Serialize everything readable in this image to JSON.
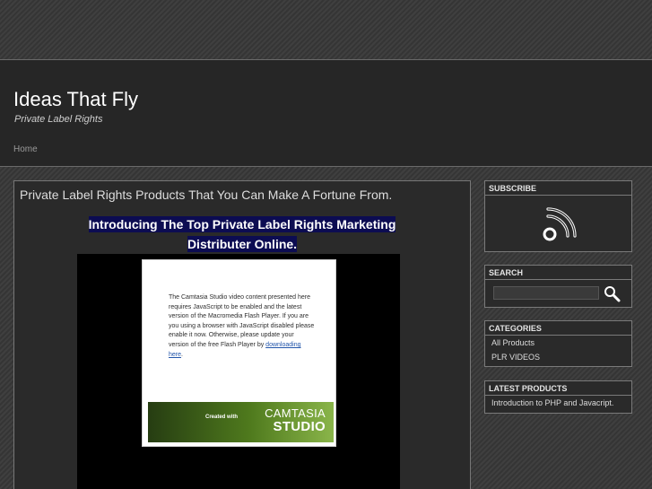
{
  "site": {
    "title": "Ideas That Fly",
    "tagline": "Private Label Rights",
    "nav": [
      {
        "label": "Home"
      }
    ]
  },
  "post": {
    "title": "Private Label Rights Products That You Can Make A Fortune From.",
    "promo_line1": "Introducing The Top Private Label Rights Marketing",
    "promo_line2": "Distributer Online.",
    "flash_message": "The Camtasia Studio video content presented here requires JavaScript to be enabled and the latest version of the Macromedia Flash Player. If you are you using a browser with JavaScript disabled please enable it now. Otherwise, please update your version of the free Flash Player by",
    "flash_link": "downloading here",
    "flash_tail": ".",
    "banner_created_with": "Created with",
    "banner_brand": "CAMTASIA",
    "banner_product": "STUDIO"
  },
  "sidebar": {
    "subscribe": {
      "title": "SUBSCRIBE",
      "icon": "rss-icon"
    },
    "search": {
      "title": "SEARCH",
      "placeholder": "",
      "icon": "magnifier-icon"
    },
    "categories": {
      "title": "CATEGORIES",
      "items": [
        "All Products",
        "PLR VIDEOS"
      ]
    },
    "latest": {
      "title": "LATEST PRODUCTS",
      "items": [
        "Introduction to PHP and Javacript."
      ]
    }
  },
  "colors": {
    "promo_highlight": "#0c0c52",
    "header_bg": "#262626",
    "camtasia_green": "#4f7a1d"
  }
}
